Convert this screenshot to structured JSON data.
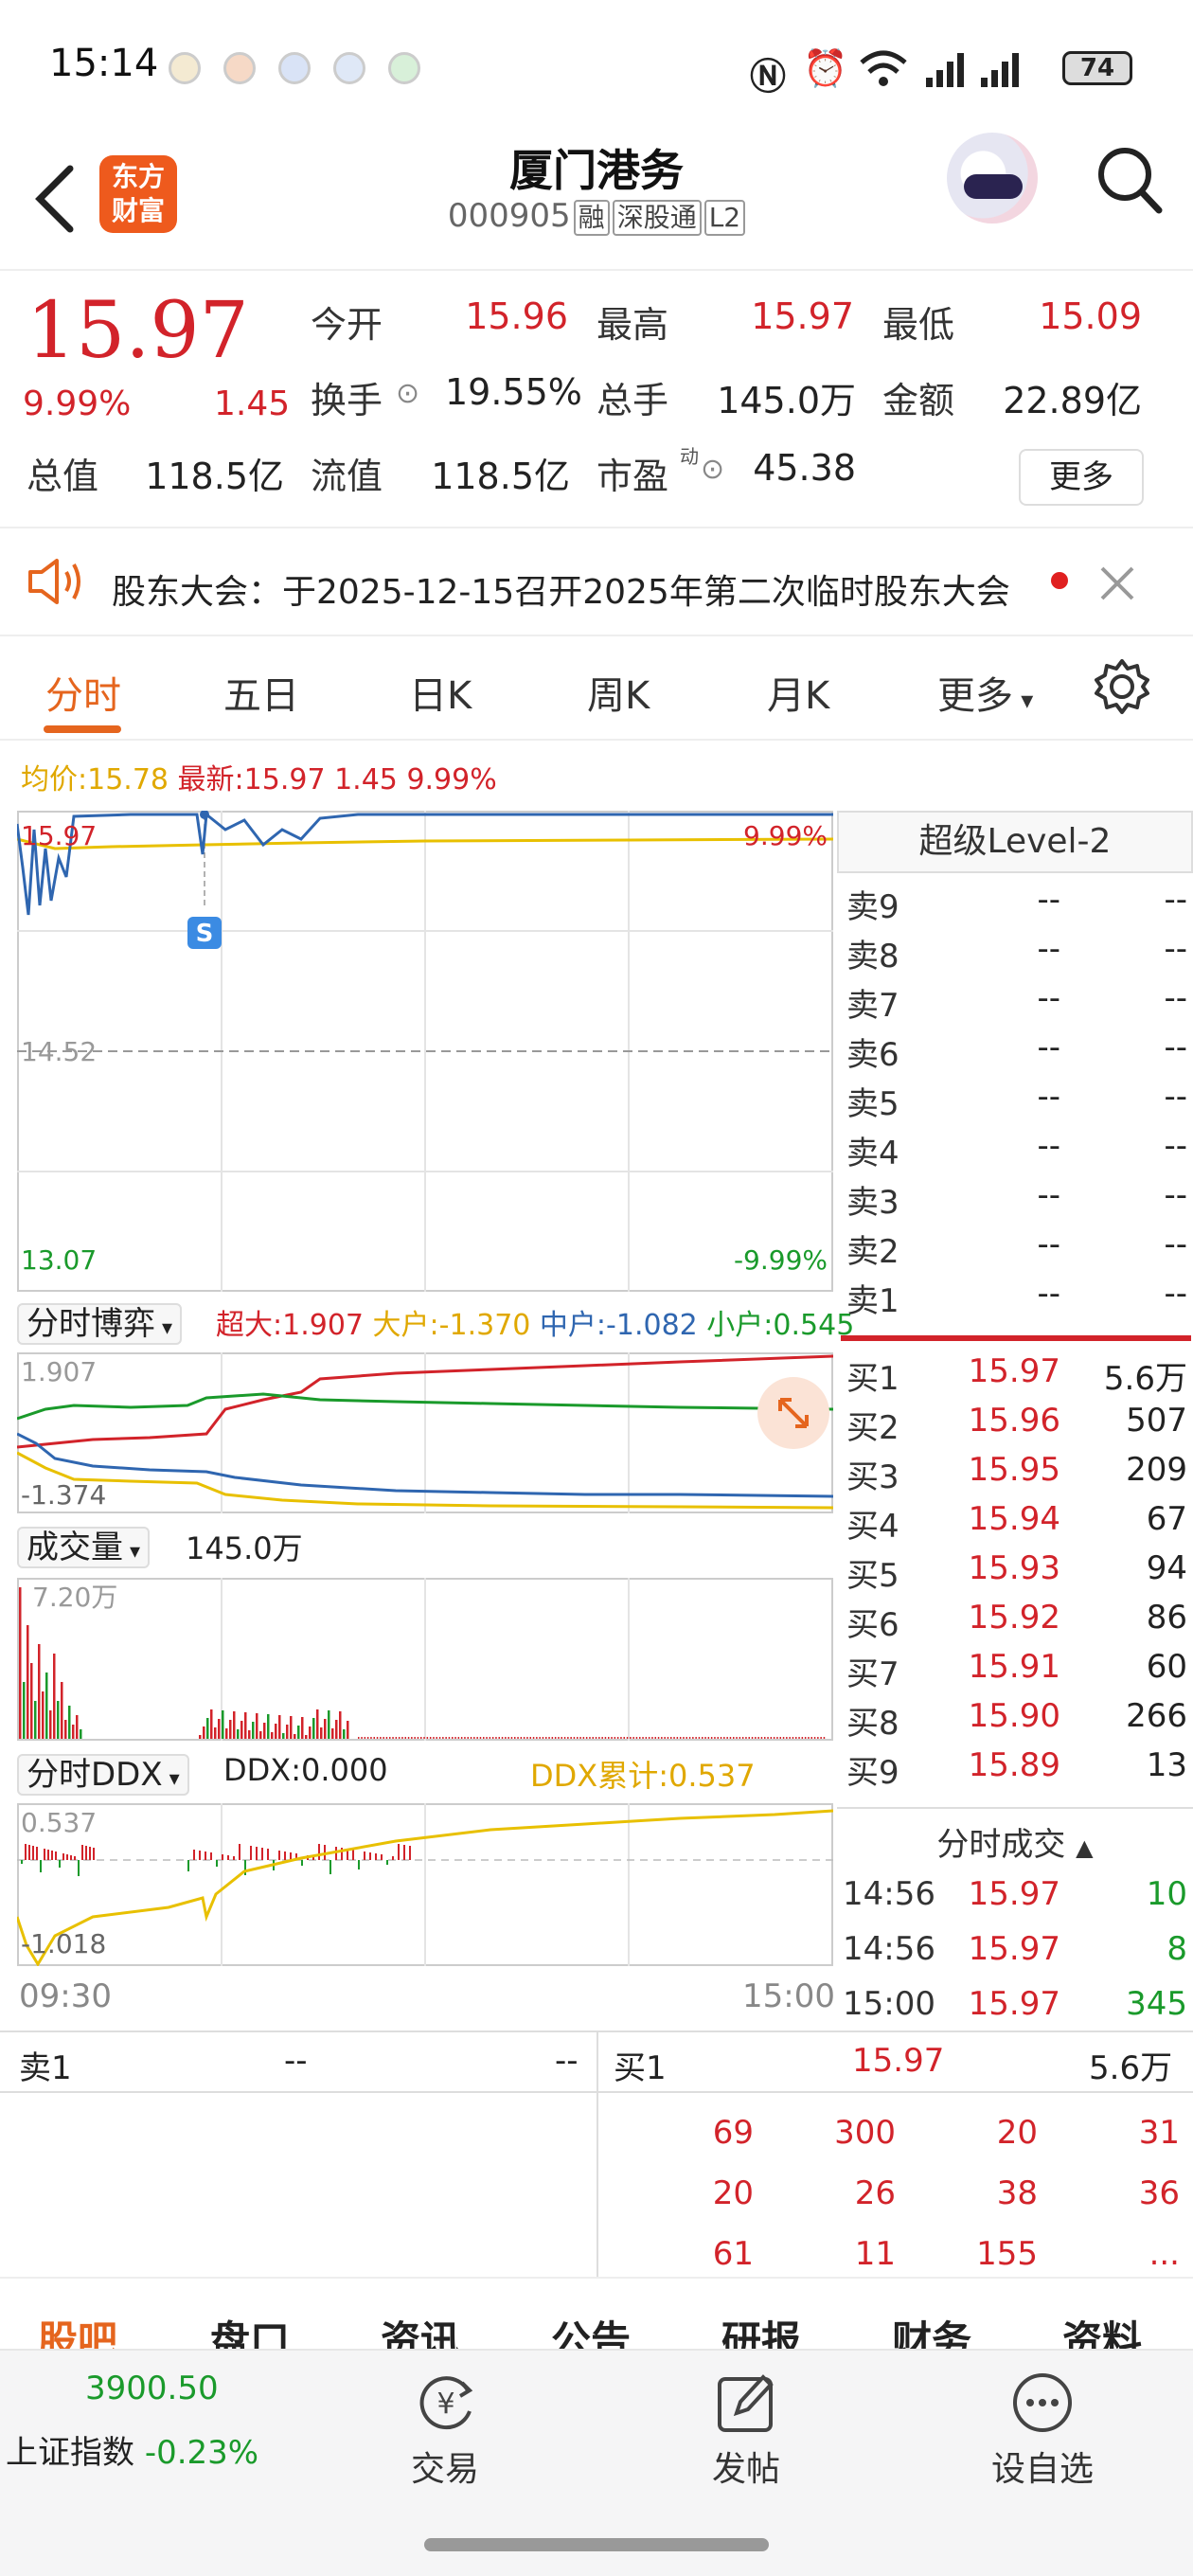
{
  "status_bar": {
    "time": "15:14",
    "battery": "74"
  },
  "header": {
    "logo_line1": "东方",
    "logo_line2": "财富",
    "stock_name": "厦门港务",
    "stock_code": "000905",
    "tags": [
      "融",
      "深股通",
      "L2"
    ]
  },
  "quote": {
    "price": "15.97",
    "change_pct": "9.99%",
    "change": "1.45",
    "open_label": "今开",
    "open": "15.96",
    "high_label": "最高",
    "high": "15.97",
    "low_label": "最低",
    "low": "15.09",
    "turnover_label": "换手",
    "turnover": "19.55%",
    "volume_label": "总手",
    "volume": "145.0万",
    "amount_label": "金额",
    "amount": "22.89亿",
    "mktcap_label": "总值",
    "mktcap": "118.5亿",
    "float_label": "流值",
    "float_cap": "118.5亿",
    "pe_label": "市盈",
    "pe_sup": "动",
    "pe": "45.38",
    "more": "更多"
  },
  "notice": {
    "text": "股东大会：于2025-12-15召开2025年第二次临时股东大会"
  },
  "tabs": [
    "分时",
    "五日",
    "日K",
    "周K",
    "月K",
    "更多"
  ],
  "legend": {
    "avg_label": "均价:",
    "avg": "15.78",
    "last_label": "最新:",
    "last": "15.97",
    "chg": "1.45",
    "pct": "9.99%"
  },
  "chart_data": [
    {
      "type": "line",
      "series": [
        {
          "values": [
            15.4,
            15.6,
            15.97,
            15.97,
            15.7,
            15.97,
            15.9,
            15.97,
            15.97,
            15.97
          ]
        },
        {
          "values": [
            15.5,
            15.55,
            15.6,
            15.62,
            15.65,
            15.7,
            15.72,
            15.75,
            15.77,
            15.78
          ]
        }
      ],
      "ylim": [
        13.07,
        15.97
      ],
      "tick_top": "15.97",
      "tick_mid": "14.52",
      "tick_bottom": "13.07",
      "pct_top": "9.99%",
      "pct_bottom": "-9.99%",
      "marker": "S"
    },
    {
      "type": "line",
      "selector": "分时博弈",
      "labels": {
        "super": "超大:1.907",
        "large": "大户:-1.370",
        "mid": "中户:-1.082",
        "small": "小户:0.545"
      },
      "tick_top": "1.907",
      "tick_bottom": "-1.374"
    },
    {
      "type": "bar",
      "selector": "成交量",
      "total": "145.0万",
      "tick_top": "7.20万"
    },
    {
      "type": "line",
      "selector": "分时DDX",
      "ddx": "DDX:0.000",
      "ddx_cum": "DDX累计:0.537",
      "tick_top": "0.537",
      "tick_bottom": "-1.018",
      "time_start": "09:30",
      "time_end": "15:00"
    }
  ],
  "book": {
    "title": "超级Level-2",
    "asks": [
      {
        "label": "卖9",
        "price": "--",
        "vol": "--"
      },
      {
        "label": "卖8",
        "price": "--",
        "vol": "--"
      },
      {
        "label": "卖7",
        "price": "--",
        "vol": "--"
      },
      {
        "label": "卖6",
        "price": "--",
        "vol": "--"
      },
      {
        "label": "卖5",
        "price": "--",
        "vol": "--"
      },
      {
        "label": "卖4",
        "price": "--",
        "vol": "--"
      },
      {
        "label": "卖3",
        "price": "--",
        "vol": "--"
      },
      {
        "label": "卖2",
        "price": "--",
        "vol": "--"
      },
      {
        "label": "卖1",
        "price": "--",
        "vol": "--"
      }
    ],
    "bids": [
      {
        "label": "买1",
        "price": "15.97",
        "vol": "5.6万"
      },
      {
        "label": "买2",
        "price": "15.96",
        "vol": "507"
      },
      {
        "label": "买3",
        "price": "15.95",
        "vol": "209"
      },
      {
        "label": "买4",
        "price": "15.94",
        "vol": "67"
      },
      {
        "label": "买5",
        "price": "15.93",
        "vol": "94"
      },
      {
        "label": "买6",
        "price": "15.92",
        "vol": "86"
      },
      {
        "label": "买7",
        "price": "15.91",
        "vol": "60"
      },
      {
        "label": "买8",
        "price": "15.90",
        "vol": "266"
      },
      {
        "label": "买9",
        "price": "15.89",
        "vol": "13"
      }
    ],
    "trades_title": "分时成交",
    "trades": [
      {
        "time": "14:56",
        "price": "15.97",
        "vol": "10"
      },
      {
        "time": "14:56",
        "price": "15.97",
        "vol": "8"
      },
      {
        "time": "15:00",
        "price": "15.97",
        "vol": "345"
      }
    ]
  },
  "ticks": {
    "sell_label": "卖1",
    "sell_price": "--",
    "sell_vol": "--",
    "buy_label": "买1",
    "buy_price": "15.97",
    "buy_vol": "5.6万",
    "rows": [
      [
        "69",
        "300",
        "20",
        "31"
      ],
      [
        "20",
        "26",
        "38",
        "36"
      ],
      [
        "61",
        "11",
        "155",
        "..."
      ]
    ]
  },
  "bottom_tabs": [
    "股吧",
    "盘口",
    "资讯",
    "公告",
    "研报",
    "财务",
    "资料"
  ],
  "bottom_bar": {
    "index_value": "3900.50",
    "index_name": "上证指数",
    "index_chg": "-0.23%",
    "trade": "交易",
    "post": "发帖",
    "watch": "设自选"
  }
}
